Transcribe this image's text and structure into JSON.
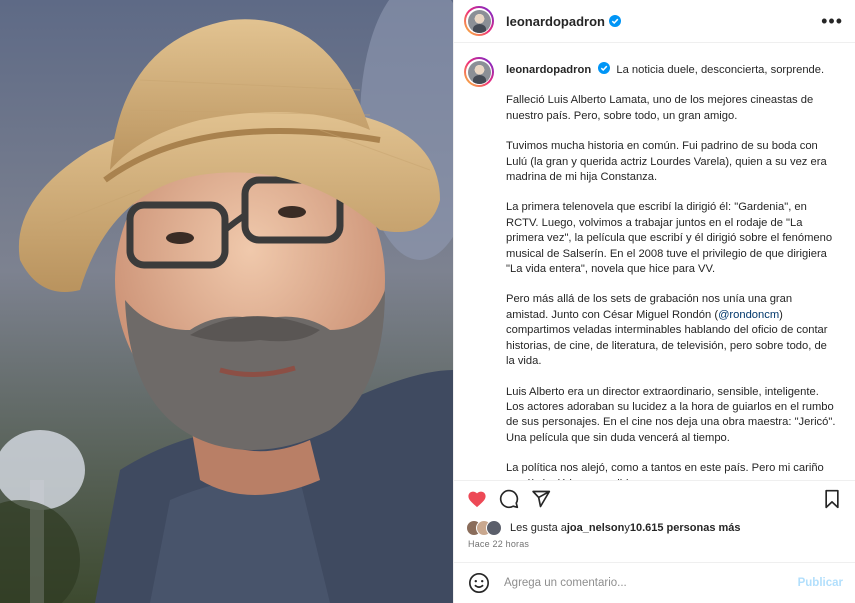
{
  "post": {
    "username": "leonardopadron",
    "verified": true,
    "more_label": "•••",
    "photo_alt": "Luis Alberto Lamata"
  },
  "caption": {
    "username": "leonardopadron",
    "paragraphs": [
      "La noticia duele, desconcierta, sorprende.",
      "Falleció Luis Alberto Lamata, uno de los mejores cineastas de nuestro país. Pero, sobre todo, un gran amigo.",
      "Tuvimos mucha historia en común. Fui padrino de su boda con Lulú (la gran y querida actriz Lourdes Varela), quien a su vez era madrina de mi hija Constanza.",
      "La primera telenovela que escribí la dirigió él: \"Gardenia\", en RCTV. Luego, volvimos a trabajar juntos en el rodaje de \"La primera vez\", la película que escribí y él dirigió sobre el fenómeno musical de Salserín. En el 2008 tuve el privilegio de que dirigiera \"La vida entera\", novela que hice para VV.",
      "Luis Alberto era un director extraordinario, sensible, inteligente. Los actores adoraban su lucidez a la hora de guiarlos en el rumbo de sus personajes. En el cine nos deja una obra maestra: \"Jericó\". Una película que sin duda vencerá al tiempo.",
      "La política nos alejó, como a tantos en este país. Pero mi cariño por él siguió inconmovible."
    ],
    "p5_before": "Pero más allá de los sets de grabación nos unía una gran amistad. Junto con César Miguel Rondón (",
    "p5_mention": "@rondoncm",
    "p5_after": ") compartimos veladas interminables hablando del oficio de contar historias, de cine, de literatura, de televisión, pero sobre todo, de la vida."
  },
  "likes": {
    "prefix": "Les gusta a ",
    "user": "joa_nelson",
    "middle": " y ",
    "count": "10.615 personas más"
  },
  "time": "Hace 22 horas",
  "comment": {
    "placeholder": "Agrega un comentario...",
    "publish": "Publicar"
  },
  "icons": [
    "heart-filled-icon",
    "comment-icon",
    "share-icon",
    "bookmark-icon",
    "emoji-icon",
    "verified-icon"
  ],
  "colors": {
    "like": "#ed4956",
    "verified": "#0095f6",
    "publish": "#b2dffc",
    "mention": "#00376b"
  }
}
